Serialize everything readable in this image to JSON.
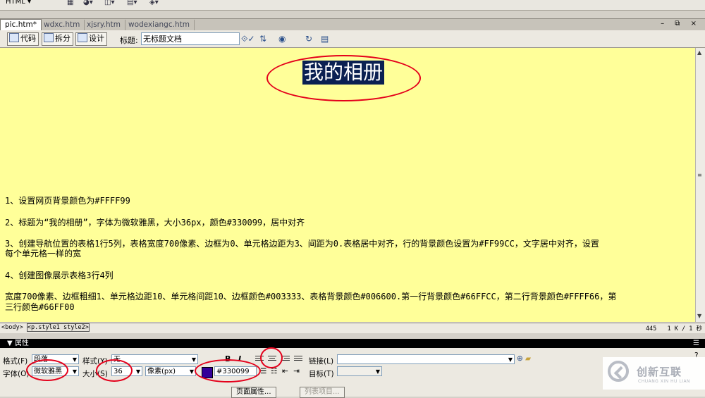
{
  "topbar": {
    "mode_label": "HTML ▾"
  },
  "tabs": [
    {
      "label": "pic.htm*",
      "active": true
    },
    {
      "label": "wdxc.htm",
      "active": false
    },
    {
      "label": "xjsry.htm",
      "active": false
    },
    {
      "label": "wodexiangc.htm",
      "active": false
    }
  ],
  "window_controls": "– ⧉ ×",
  "doc_toolbar": {
    "code_label": "代码",
    "split_label": "拆分",
    "design_label": "设计",
    "title_label": "标题:",
    "title_value": "无标题文档"
  },
  "canvas": {
    "background": "#FFFF99",
    "heading": "我的相册",
    "lines": [
      "1、设置网页背景颜色为#FFFF99",
      "2、标题为“我的相册”，字体为微软雅黑，大小36px，颜色#330099，居中对齐",
      "3、创建导航位置的表格1行5列，表格宽度700像素、边框为0、单元格边距为3、间距为0.表格居中对齐，行的背景颜色设置为#FF99CC，文字居中对齐，设置",
      "每个单元格一样的宽",
      "4、创建图像展示表格3行4列",
      "宽度700像素、边框粗细1、单元格边距10、单元格间距10、边框颜色#003333、表格背景颜色#006600.第一行背景颜色#66FFCC，第二行背景颜色#FFFF66，第",
      "三行颜色#66FF00"
    ]
  },
  "statusbar": {
    "tag_body": "<body>",
    "tag_selected": "<p.style1 style2>",
    "size": "445",
    "filesize": "1 K / 1 秒"
  },
  "properties": {
    "header": "▼ 属性",
    "format_label": "格式(F)",
    "format_value": "段落",
    "style_label": "样式(Y)",
    "style_value": "无",
    "font_label": "字体(O)",
    "font_value": "微软雅黑",
    "size_label": "大小(S)",
    "size_value": "36",
    "unit_value": "像素(px)",
    "color_value": "#330099",
    "link_label": "链接(L)",
    "target_label": "目标(T)",
    "bold": "B",
    "italic": "I",
    "page_props_button": "页面属性...",
    "list_item_button": "列表项目..."
  },
  "watermark": {
    "cn": "创新互联",
    "en": "CHUANG XIN HU LIAN"
  },
  "colors": {
    "heading_bg": "#0b2052",
    "annotation": "#e4001b",
    "swatch": "#330099"
  }
}
